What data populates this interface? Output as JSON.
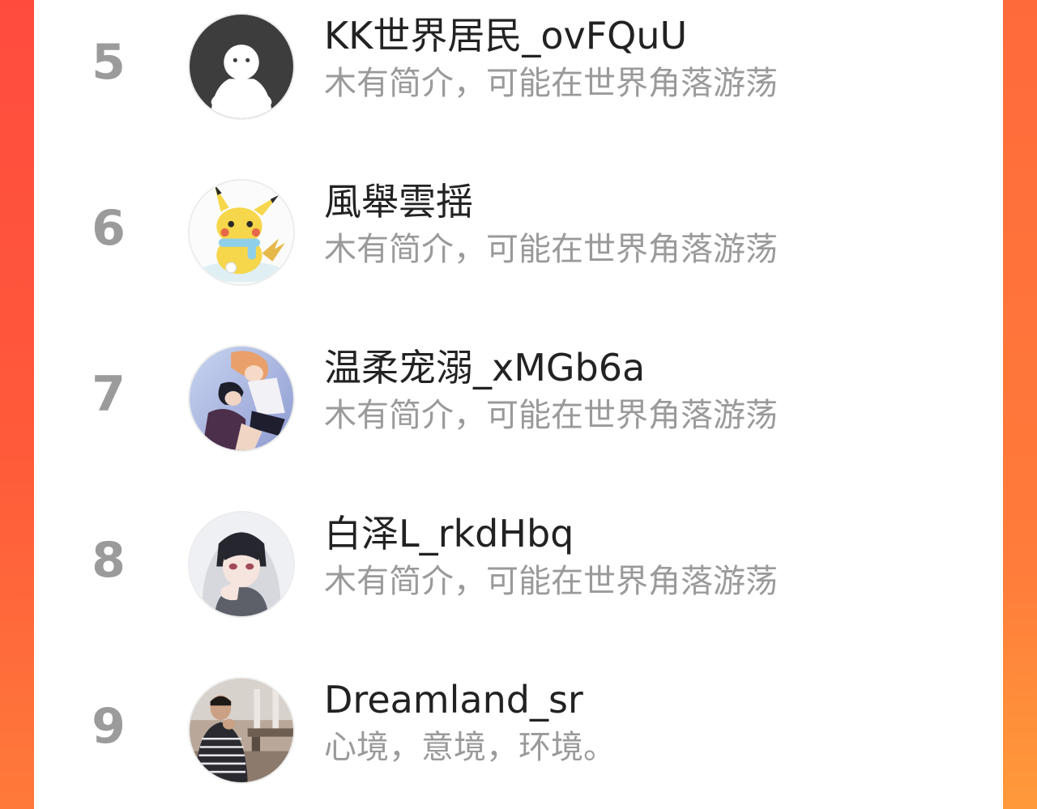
{
  "colors": {
    "background_gradient_start": "#ff4b3e",
    "background_gradient_end": "#ff7a3a",
    "card": "#ffffff",
    "rank_text": "#9b9b9b",
    "name_text": "#222222",
    "bio_text": "#9a9a9a"
  },
  "ranking": [
    {
      "rank": "5",
      "name": "KK世界居民_ovFQuU",
      "bio": "木有简介，可能在世界角落游荡",
      "avatar": "default-ghost-avatar"
    },
    {
      "rank": "6",
      "name": "風舉雲揺",
      "bio": "木有简介，可能在世界角落游荡",
      "avatar": "pikachu-avatar"
    },
    {
      "rank": "7",
      "name": "温柔宠溺_xMGb6a",
      "bio": "木有简介，可能在世界角落游荡",
      "avatar": "anime-couple-avatar"
    },
    {
      "rank": "8",
      "name": "白泽L_rkdHbq",
      "bio": "木有简介，可能在世界角落游荡",
      "avatar": "anime-boy-hoodie-avatar"
    },
    {
      "rank": "9",
      "name": "Dreamland_sr",
      "bio": "心境，意境，环境。",
      "avatar": "photo-man-restaurant-avatar"
    }
  ]
}
